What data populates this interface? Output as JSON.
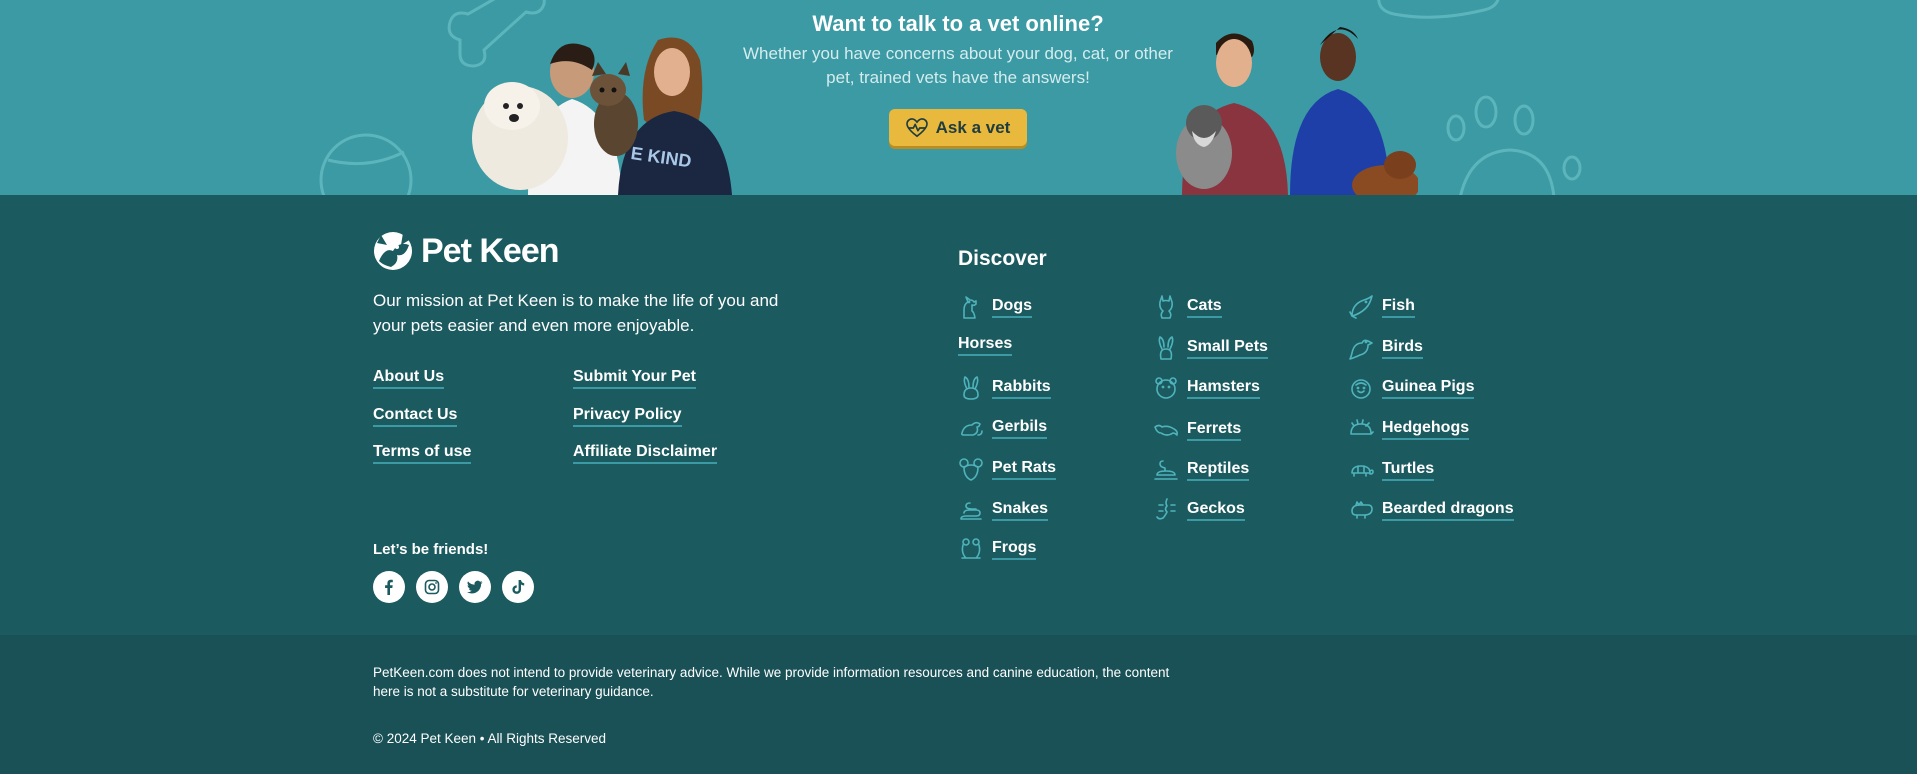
{
  "banner": {
    "title": "Want to talk to a vet online?",
    "subtitle": "Whether you have concerns about your dog, cat, or other pet, trained vets have the answers!",
    "cta_label": "Ask a vet",
    "cta_icon": "heart-pulse-icon"
  },
  "brand": {
    "name": "Pet Keen",
    "mission": "Our mission at Pet Keen is to make the life of you and your pets easier and even more enjoyable."
  },
  "footer_links": [
    {
      "label": "About Us"
    },
    {
      "label": "Submit Your Pet"
    },
    {
      "label": "Contact Us"
    },
    {
      "label": "Privacy Policy"
    },
    {
      "label": "Terms of use"
    },
    {
      "label": "Affiliate Disclaimer"
    }
  ],
  "social": {
    "heading": "Let’s be friends!",
    "icons": [
      "facebook-icon",
      "instagram-icon",
      "twitter-icon",
      "tiktok-icon"
    ]
  },
  "discover": {
    "heading": "Discover",
    "items": [
      {
        "label": "Dogs",
        "icon": "dog-icon"
      },
      {
        "label": "Cats",
        "icon": "cat-icon"
      },
      {
        "label": "Fish",
        "icon": "fish-icon"
      },
      {
        "label": "Horses",
        "icon": ""
      },
      {
        "label": "Small Pets",
        "icon": "rabbit-icon"
      },
      {
        "label": "Birds",
        "icon": "bird-icon"
      },
      {
        "label": "Rabbits",
        "icon": "rabbit-icon"
      },
      {
        "label": "Hamsters",
        "icon": "hamster-icon"
      },
      {
        "label": "Guinea Pigs",
        "icon": "guinea-pig-icon"
      },
      {
        "label": "Gerbils",
        "icon": "gerbil-icon"
      },
      {
        "label": "Ferrets",
        "icon": "ferret-icon"
      },
      {
        "label": "Hedgehogs",
        "icon": "hedgehog-icon"
      },
      {
        "label": "Pet Rats",
        "icon": "rat-icon"
      },
      {
        "label": "Reptiles",
        "icon": "reptile-icon"
      },
      {
        "label": "Turtles",
        "icon": "turtle-icon"
      },
      {
        "label": "Snakes",
        "icon": "snake-icon"
      },
      {
        "label": "Geckos",
        "icon": "gecko-icon"
      },
      {
        "label": "Bearded dragons",
        "icon": "bearded-dragon-icon"
      },
      {
        "label": "Frogs",
        "icon": "frog-icon"
      }
    ]
  },
  "legal": {
    "disclaimer": "PetKeen.com does not intend to provide veterinary advice. While we provide information resources and canine education, the content here is not a substitute for veterinary guidance.",
    "copyright": "© 2024 Pet Keen • All Rights Reserved"
  }
}
